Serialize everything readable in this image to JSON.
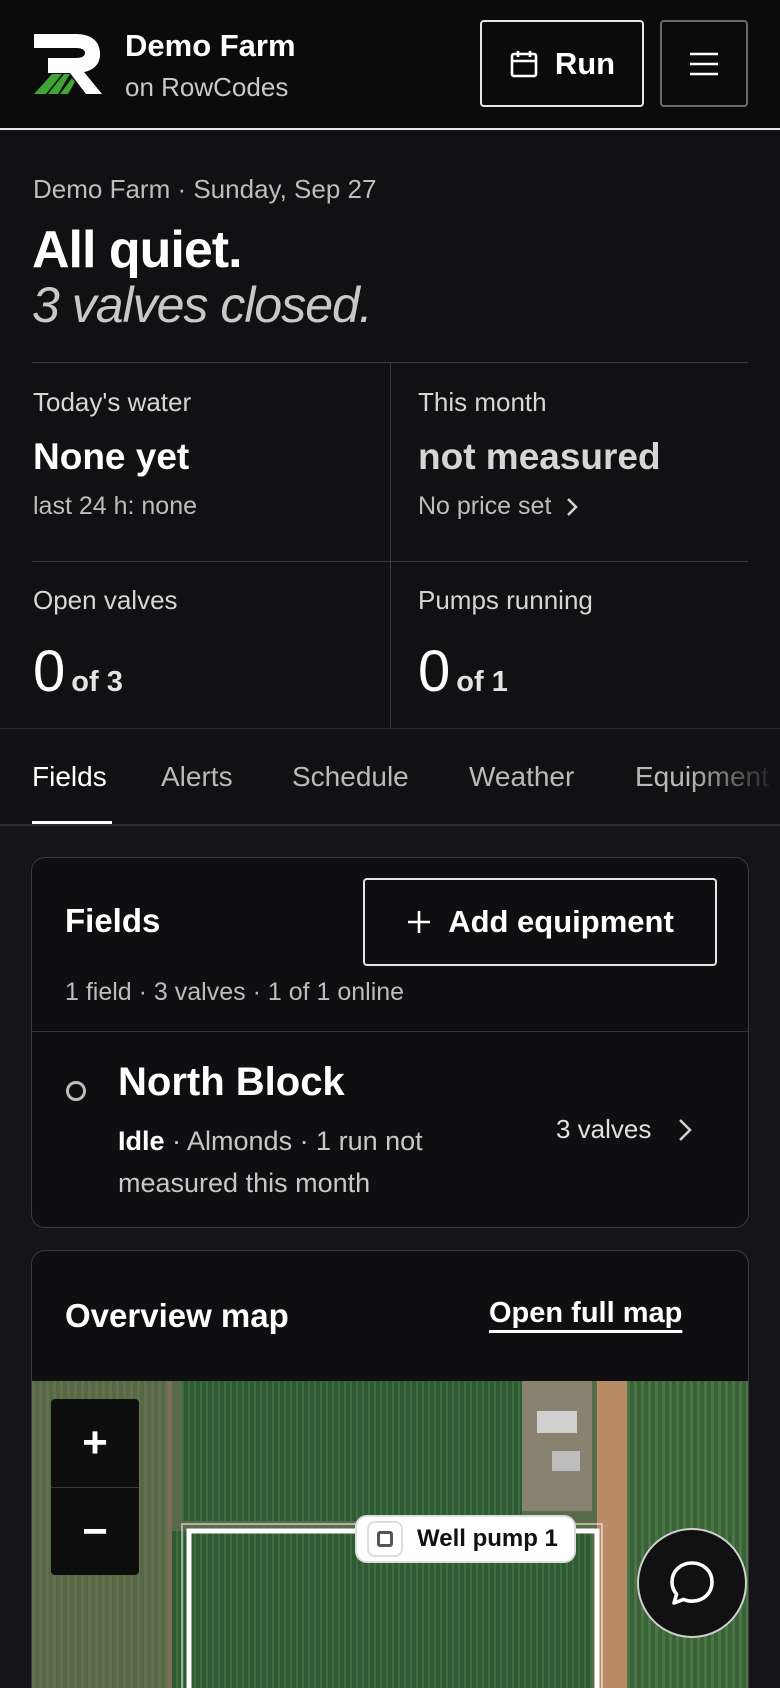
{
  "header": {
    "brand_title": "Demo Farm",
    "brand_subtitle": "on RowCodes",
    "run_label": "Run"
  },
  "summary": {
    "date_line": "Demo Farm · Sunday, Sep 27",
    "headline": "All quiet.",
    "subheadline": "3 valves closed.",
    "todays_water": {
      "label": "Today's water",
      "value": "None yet",
      "sub": "last 24 h: none"
    },
    "this_month": {
      "label": "This month",
      "value": "not measured",
      "sub": "No price set"
    },
    "open_valves": {
      "label": "Open valves",
      "count": "0",
      "total": "of 3"
    },
    "pumps_running": {
      "label": "Pumps running",
      "count": "0",
      "total": "of 1"
    }
  },
  "tabs": [
    "Fields",
    "Alerts",
    "Schedule",
    "Weather",
    "Equipment"
  ],
  "active_tab": "Fields",
  "fields_card": {
    "title": "Fields",
    "add_label": "Add equipment",
    "meta": "1 field · 3 valves · 1 of 1 online",
    "field": {
      "name": "North Block",
      "status": "Idle",
      "details": " · Almonds · 1 run not measured this month",
      "valves": "3 valves"
    }
  },
  "map_card": {
    "title": "Overview map",
    "link": "Open full map",
    "zoom_in": "+",
    "zoom_out": "−",
    "pump_label": "Well pump 1"
  },
  "colors": {
    "accent_green": "#3fa535",
    "background": "#111113",
    "card_border": "#3c3c40"
  }
}
